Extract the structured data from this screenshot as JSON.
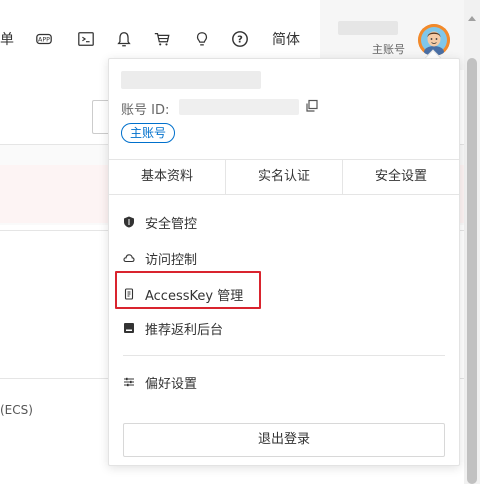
{
  "topbar": {
    "item_order_label": "单",
    "lang_label": "简体"
  },
  "user": {
    "account_type": "主账号"
  },
  "background": {
    "ecs_text": "(ECS)"
  },
  "panel": {
    "id_label": "账号 ID:",
    "account_badge": "主账号",
    "tabs": [
      {
        "label": "基本资料"
      },
      {
        "label": "实名认证"
      },
      {
        "label": "安全设置"
      }
    ],
    "menu": [
      {
        "label": "安全管控",
        "icon": "shield-icon"
      },
      {
        "label": "访问控制",
        "icon": "cloud-icon"
      },
      {
        "label": "AccessKey 管理",
        "icon": "key-icon"
      },
      {
        "label": "推荐返利后台",
        "icon": "rebate-icon"
      },
      {
        "label": "偏好设置",
        "icon": "sliders-icon"
      }
    ],
    "logout_label": "退出登录"
  },
  "colors": {
    "accent": "#0070cc",
    "highlight": "#d9242e"
  }
}
